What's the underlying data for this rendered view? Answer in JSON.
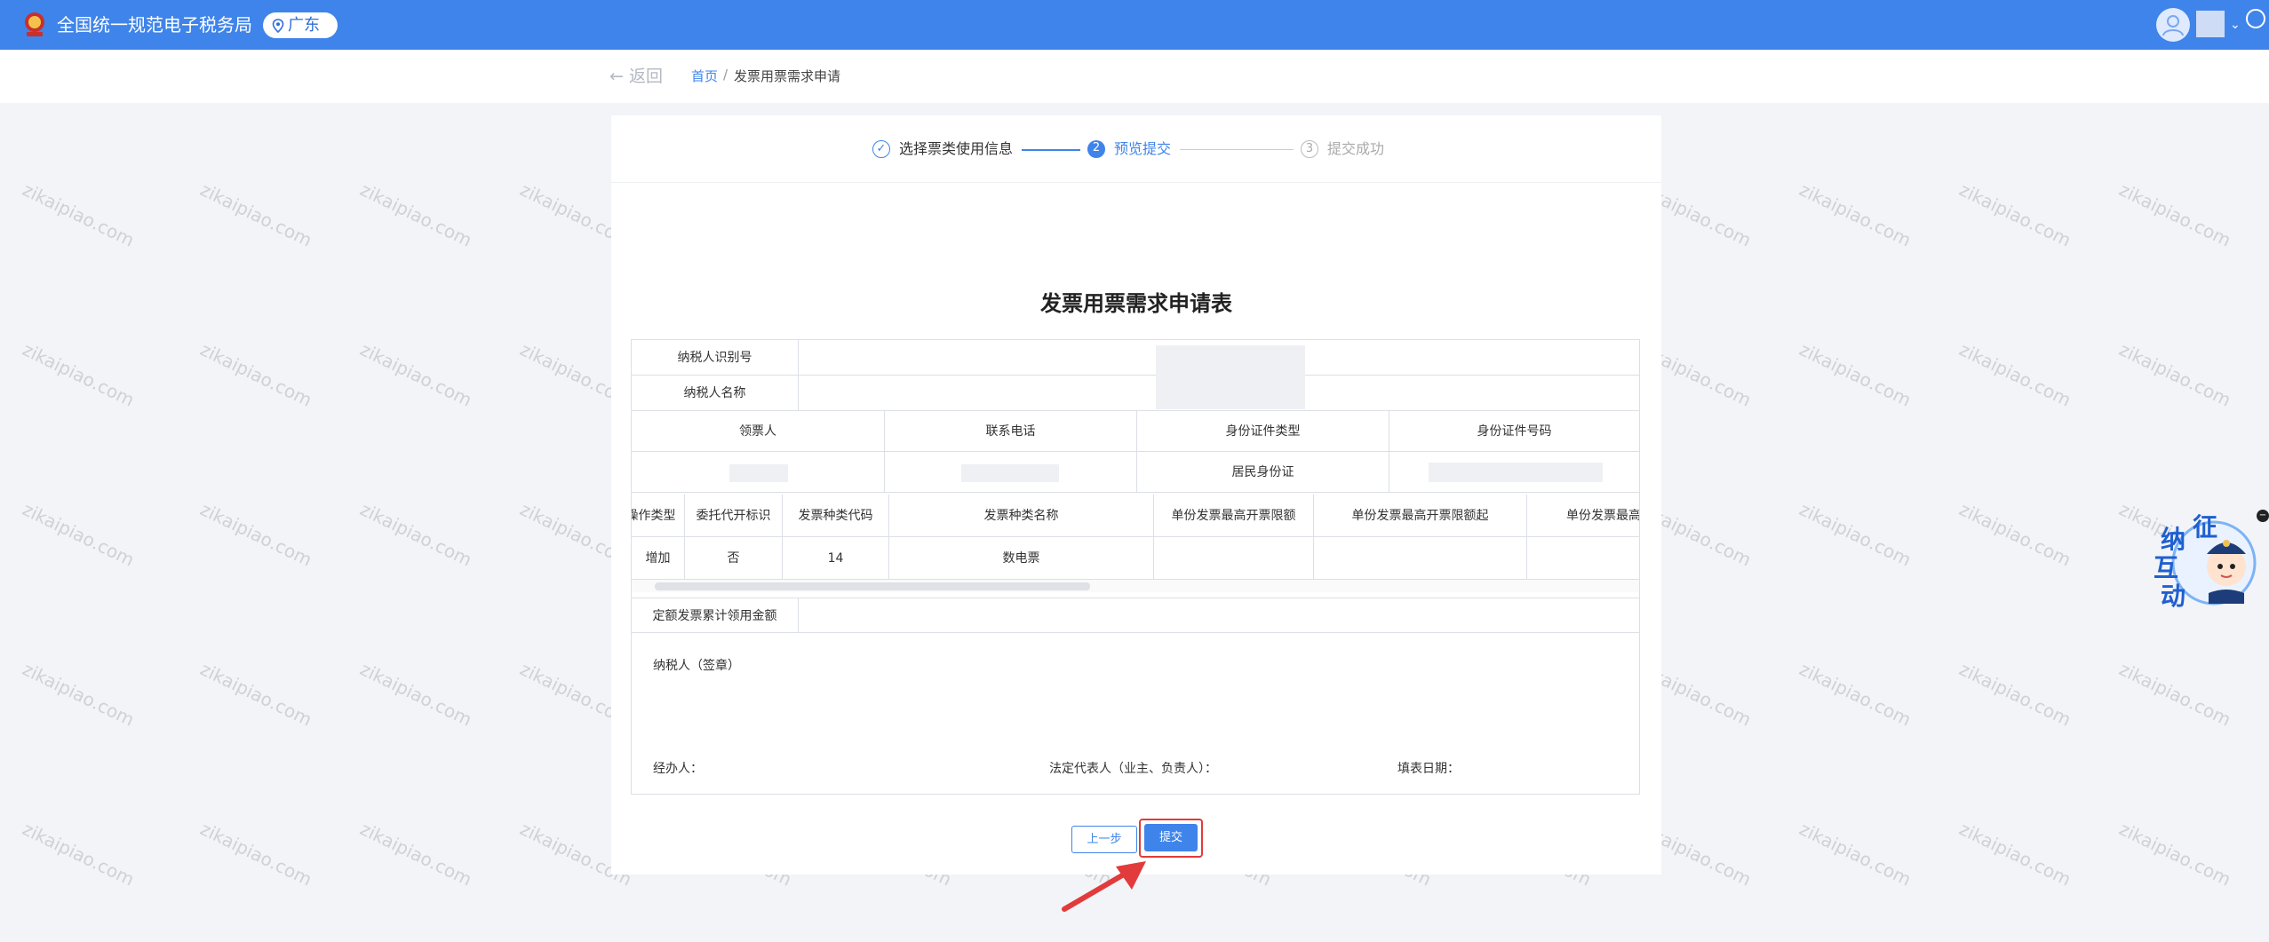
{
  "header": {
    "site_title": "全国统一规范电子税务局",
    "region": "广东"
  },
  "breadcrumb": {
    "back": "← 返回",
    "home": "首页",
    "separator": "/",
    "current": "发票用票需求申请"
  },
  "steps": [
    {
      "index": "✓",
      "label": "选择票类使用信息",
      "state": "done"
    },
    {
      "index": "2",
      "label": "预览提交",
      "state": "active"
    },
    {
      "index": "3",
      "label": "提交成功",
      "state": "pending"
    }
  ],
  "form": {
    "title": "发票用票需求申请表",
    "taxpayer_id_label": "纳税人识别号",
    "taxpayer_name_label": "纳税人名称",
    "receiver_headers": [
      "领票人",
      "联系电话",
      "身份证件类型",
      "身份证件号码"
    ],
    "receiver_row": {
      "id_type": "居民身份证"
    },
    "invoice_headers": [
      "操作类型",
      "委托代开标识",
      "发票种类代码",
      "发票种类名称",
      "单份发票最高开票限额",
      "单份发票最高开票限额起",
      "单份发票最高"
    ],
    "invoice_row": [
      "增加",
      "否",
      "14",
      "数电票",
      "",
      "",
      ""
    ],
    "quota_label": "定额发票累计领用金额",
    "sign_taxpayer": "纳税人（签章）",
    "sign_handler": "经办人：",
    "sign_legal": "法定代表人（业主、负责人）：",
    "sign_date": "填表日期："
  },
  "buttons": {
    "prev": "上一步",
    "submit": "提交"
  },
  "assistant": {
    "chars": [
      "征",
      "纳",
      "互",
      "动"
    ],
    "close": "−"
  },
  "watermark": "zikaipiao.com",
  "colors": {
    "primary": "#3f84ea",
    "highlight": "#e23b3b"
  }
}
